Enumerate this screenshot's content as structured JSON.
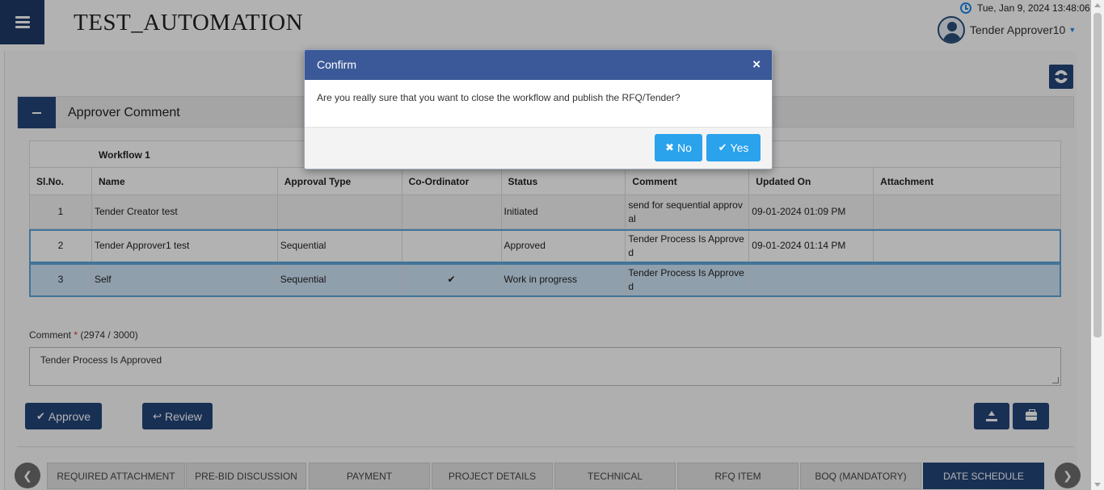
{
  "header": {
    "app_title": "TEST_AUTOMATION",
    "datetime": "Tue, Jan 9, 2024 13:48:06",
    "user_name": "Tender Approver10"
  },
  "section": {
    "title": "Approver Comment"
  },
  "workflow": {
    "title": "Workflow 1",
    "columns": [
      "Sl.No.",
      "Name",
      "Approval Type",
      "Co-Ordinator",
      "Status",
      "Comment",
      "Updated On",
      "Attachment"
    ],
    "rows": [
      {
        "sl": "1",
        "name": "Tender Creator test",
        "approval_type": "",
        "coordinator": "",
        "status": "Initiated",
        "comment": "send for sequential approval",
        "updated_on": "09-01-2024 01:09 PM",
        "attachment": ""
      },
      {
        "sl": "2",
        "name": "Tender Approver1 test",
        "approval_type": "Sequential",
        "coordinator": "",
        "status": "Approved",
        "comment": "Tender Process Is Approved",
        "updated_on": "09-01-2024 01:14 PM",
        "attachment": ""
      },
      {
        "sl": "3",
        "name": "Self",
        "approval_type": "Sequential",
        "coordinator": "✔",
        "status": "Work in progress",
        "comment": "Tender Process Is Approved",
        "updated_on": "",
        "attachment": ""
      }
    ]
  },
  "comment": {
    "label": "Comment",
    "required_mark": "*",
    "counter": "(2974 / 3000)",
    "value": "Tender Process Is Approved"
  },
  "actions": {
    "approve_label": "Approve",
    "review_label": "Review"
  },
  "tabs": [
    "REQUIRED ATTACHMENT",
    "PRE-BID DISCUSSION",
    "PAYMENT",
    "PROJECT DETAILS",
    "TECHNICAL",
    "RFQ ITEM",
    "BOQ (MANDATORY)",
    "DATE SCHEDULE"
  ],
  "active_tab": "DATE SCHEDULE",
  "modal": {
    "title": "Confirm",
    "close_glyph": "×",
    "message": "Are you really sure that you want to close the workflow and publish the RFQ/Tender?",
    "no_label": "No",
    "yes_label": "Yes"
  },
  "icons": [
    "menu-icon",
    "clock-icon",
    "user-avatar-icon",
    "lifebuoy-icon",
    "minus-icon",
    "check-icon",
    "reply-icon",
    "upload-icon",
    "briefcase-icon",
    "chevron-left-icon",
    "chevron-right-icon",
    "close-icon",
    "times-icon"
  ],
  "colors": {
    "navy": "#24467a",
    "modal_header": "#3b5998",
    "modal_button": "#2aa2ec",
    "selected_row": "#cfe4f6",
    "row_border": "#5da6dc"
  }
}
